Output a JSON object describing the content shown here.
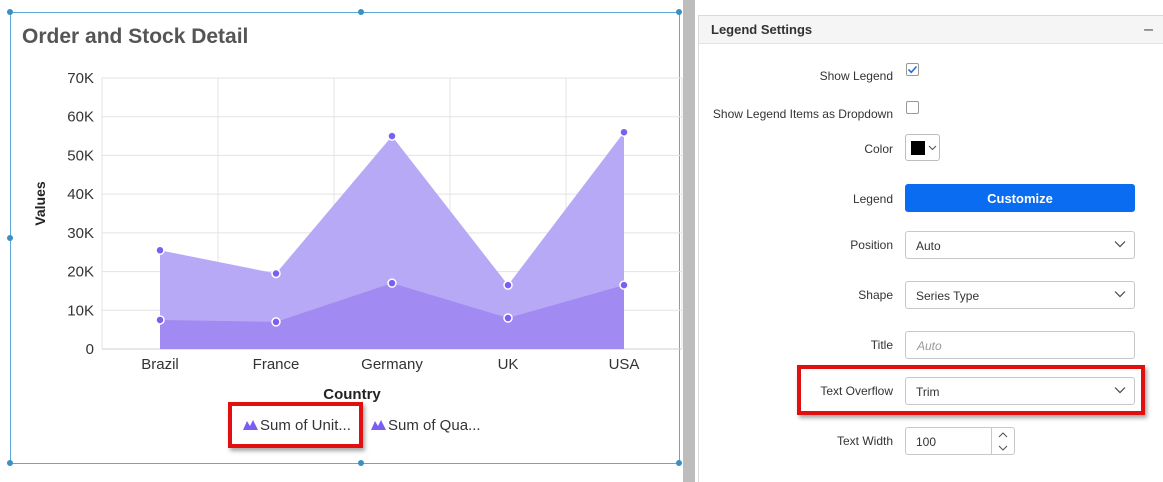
{
  "widget": {
    "title": "Order and Stock Detail"
  },
  "chart_data": {
    "type": "area",
    "categories": [
      "Brazil",
      "France",
      "Germany",
      "UK",
      "USA"
    ],
    "series": [
      {
        "name": "Sum of Unit...",
        "values": [
          25500,
          19500,
          55000,
          16500,
          56000
        ],
        "color": "#b8a9f6"
      },
      {
        "name": "Sum of Qua...",
        "values": [
          7500,
          7000,
          17000,
          8000,
          16500
        ],
        "color": "#9d85f2"
      }
    ],
    "y_ticks": [
      "0",
      "10K",
      "20K",
      "30K",
      "40K",
      "50K",
      "60K",
      "70K"
    ],
    "ylim": [
      0,
      70000
    ],
    "xlabel": "Country",
    "ylabel": "Values",
    "grid": true,
    "legend_position": "bottom",
    "point_color": "#7b5ff0"
  },
  "panel": {
    "title": "Legend Settings",
    "collapse_icon": "minus-icon",
    "show_legend": {
      "label": "Show Legend",
      "checked": true
    },
    "show_dropdown": {
      "label": "Show Legend Items as Dropdown",
      "checked": false
    },
    "color": {
      "label": "Color",
      "value": "#000000"
    },
    "legend": {
      "label": "Legend",
      "button_label": "Customize"
    },
    "position": {
      "label": "Position",
      "value": "Auto"
    },
    "shape": {
      "label": "Shape",
      "value": "Series Type"
    },
    "title_field": {
      "label": "Title",
      "placeholder": "Auto"
    },
    "text_overflow": {
      "label": "Text Overflow",
      "value": "Trim"
    },
    "text_width": {
      "label": "Text Width",
      "value": "100"
    }
  },
  "colors": {
    "accent": "#0a6cf0",
    "highlight": "#e01010",
    "selection_border": "#5fa9d8"
  }
}
